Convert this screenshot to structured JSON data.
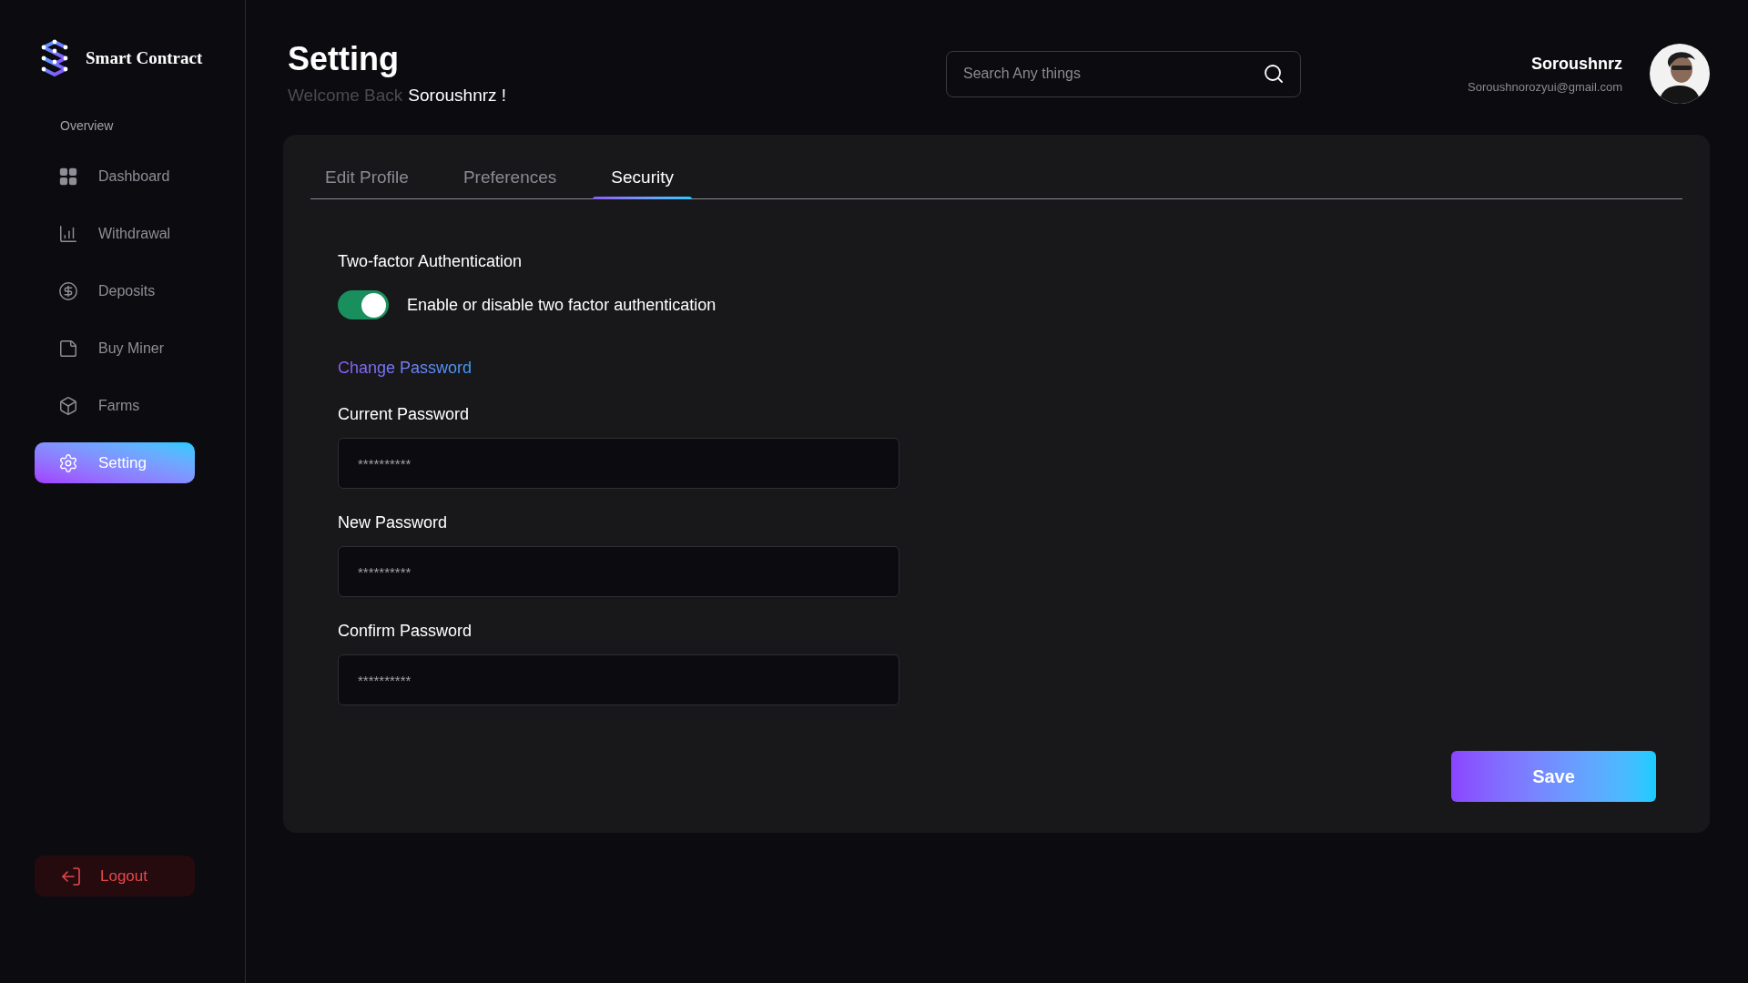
{
  "sidebar": {
    "brand": "Smart Contract",
    "section": "Overview",
    "items": [
      {
        "label": "Dashboard",
        "selected": false
      },
      {
        "label": "Withdrawal",
        "selected": false
      },
      {
        "label": "Deposits",
        "selected": false
      },
      {
        "label": "Buy Miner",
        "selected": false
      },
      {
        "label": "Farms",
        "selected": false
      },
      {
        "label": "Setting",
        "selected": true
      }
    ],
    "logout": "Logout"
  },
  "header": {
    "title": "Setting",
    "welcome": "Welcome Back",
    "welcome_name": "Soroushnrz !",
    "search": {
      "placeholder": "Search Any things"
    },
    "user": {
      "name": "Soroushnrz",
      "email": "Soroushnorozyui@gmail.com"
    }
  },
  "tabs": [
    {
      "label": "Edit Profile",
      "selected": false
    },
    {
      "label": "Preferences",
      "selected": false
    },
    {
      "label": "Security",
      "selected": true
    }
  ],
  "two_factor": {
    "heading": "Two-factor Authentication",
    "label": "Enable or disable two factor authentication",
    "on": true
  },
  "change_password": {
    "heading": "Change Password",
    "fields": [
      {
        "label": "Current Password",
        "value": "**********"
      },
      {
        "label": "New Password",
        "value": "**********"
      },
      {
        "label": "Confirm Password",
        "value": "**********"
      }
    ]
  },
  "save": "Save"
}
